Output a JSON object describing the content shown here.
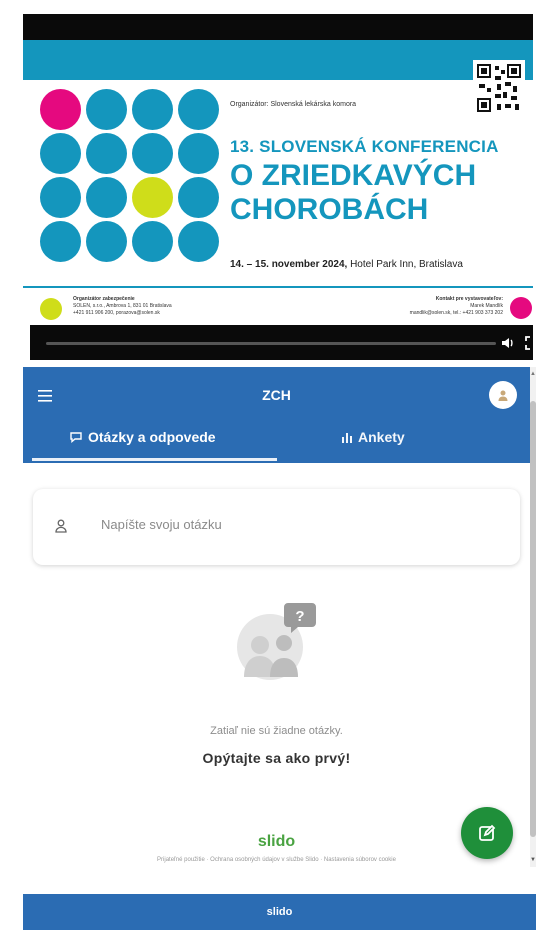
{
  "video": {
    "organizer_top": "Organizátor: Slovenská lekárska komora",
    "conference_line1": "13. SLOVENSKÁ KONFERENCIA",
    "conference_line2": "O ZRIEDKAVÝCH",
    "conference_line3": "CHOROBÁCH",
    "date_bold": "14. – 15. november 2024,",
    "date_rest": " Hotel Park Inn, Bratislava",
    "footer_left_title": "Organizátor zabezpečenie",
    "footer_left_line1": "SOLEN, s.r.o., Ambrova 1, 831 01 Bratislava",
    "footer_left_line2": "+421 911 906 200, porazova@solen.sk",
    "footer_right_title": "Kontakt pre vystavovateľov:",
    "footer_right_line1": "Marek Mandlík",
    "footer_right_line2": "mandlik@solen.sk, tel.: +421 903 373 202",
    "colors": {
      "teal": "#1496bd",
      "magenta": "#e5097f",
      "lime": "#cfdd1a"
    }
  },
  "header": {
    "title": "ZCH",
    "menu_icon": "hamburger-menu-icon",
    "avatar_icon": "user-avatar-icon",
    "color": "#2b6cb3"
  },
  "tabs": [
    {
      "label": "Otázky a odpovede",
      "icon": "chat-bubble-icon",
      "active": true
    },
    {
      "label": "Ankety",
      "icon": "bar-chart-icon",
      "active": false
    }
  ],
  "question_input": {
    "placeholder": "Napíšte svoju otázku"
  },
  "empty_state": {
    "message": "Zatiaľ nie sú žiadne otázky.",
    "cta": "Opýtajte sa ako prvý!"
  },
  "branding": {
    "logo": "slido",
    "legal": "Prijateľné použitie · Ochrana osobných údajov v službe Slido · Nastavenia súborov cookie"
  },
  "fab": {
    "icon": "edit-icon",
    "color": "#1f8f3a"
  },
  "footer": {
    "label": "slido"
  }
}
